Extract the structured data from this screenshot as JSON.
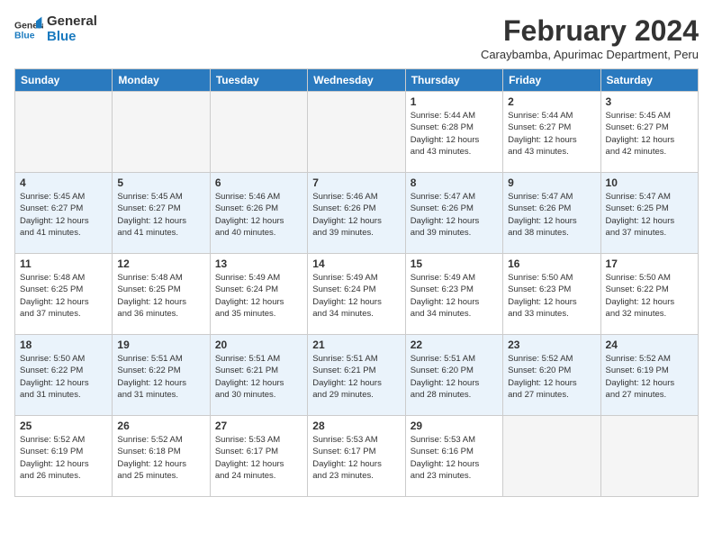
{
  "logo": {
    "text_general": "General",
    "text_blue": "Blue"
  },
  "header": {
    "month_title": "February 2024",
    "subtitle": "Caraybamba, Apurimac Department, Peru"
  },
  "days_of_week": [
    "Sunday",
    "Monday",
    "Tuesday",
    "Wednesday",
    "Thursday",
    "Friday",
    "Saturday"
  ],
  "weeks": [
    [
      {
        "day": "",
        "info": ""
      },
      {
        "day": "",
        "info": ""
      },
      {
        "day": "",
        "info": ""
      },
      {
        "day": "",
        "info": ""
      },
      {
        "day": "1",
        "info": "Sunrise: 5:44 AM\nSunset: 6:28 PM\nDaylight: 12 hours\nand 43 minutes."
      },
      {
        "day": "2",
        "info": "Sunrise: 5:44 AM\nSunset: 6:27 PM\nDaylight: 12 hours\nand 43 minutes."
      },
      {
        "day": "3",
        "info": "Sunrise: 5:45 AM\nSunset: 6:27 PM\nDaylight: 12 hours\nand 42 minutes."
      }
    ],
    [
      {
        "day": "4",
        "info": "Sunrise: 5:45 AM\nSunset: 6:27 PM\nDaylight: 12 hours\nand 41 minutes."
      },
      {
        "day": "5",
        "info": "Sunrise: 5:45 AM\nSunset: 6:27 PM\nDaylight: 12 hours\nand 41 minutes."
      },
      {
        "day": "6",
        "info": "Sunrise: 5:46 AM\nSunset: 6:26 PM\nDaylight: 12 hours\nand 40 minutes."
      },
      {
        "day": "7",
        "info": "Sunrise: 5:46 AM\nSunset: 6:26 PM\nDaylight: 12 hours\nand 39 minutes."
      },
      {
        "day": "8",
        "info": "Sunrise: 5:47 AM\nSunset: 6:26 PM\nDaylight: 12 hours\nand 39 minutes."
      },
      {
        "day": "9",
        "info": "Sunrise: 5:47 AM\nSunset: 6:26 PM\nDaylight: 12 hours\nand 38 minutes."
      },
      {
        "day": "10",
        "info": "Sunrise: 5:47 AM\nSunset: 6:25 PM\nDaylight: 12 hours\nand 37 minutes."
      }
    ],
    [
      {
        "day": "11",
        "info": "Sunrise: 5:48 AM\nSunset: 6:25 PM\nDaylight: 12 hours\nand 37 minutes."
      },
      {
        "day": "12",
        "info": "Sunrise: 5:48 AM\nSunset: 6:25 PM\nDaylight: 12 hours\nand 36 minutes."
      },
      {
        "day": "13",
        "info": "Sunrise: 5:49 AM\nSunset: 6:24 PM\nDaylight: 12 hours\nand 35 minutes."
      },
      {
        "day": "14",
        "info": "Sunrise: 5:49 AM\nSunset: 6:24 PM\nDaylight: 12 hours\nand 34 minutes."
      },
      {
        "day": "15",
        "info": "Sunrise: 5:49 AM\nSunset: 6:23 PM\nDaylight: 12 hours\nand 34 minutes."
      },
      {
        "day": "16",
        "info": "Sunrise: 5:50 AM\nSunset: 6:23 PM\nDaylight: 12 hours\nand 33 minutes."
      },
      {
        "day": "17",
        "info": "Sunrise: 5:50 AM\nSunset: 6:22 PM\nDaylight: 12 hours\nand 32 minutes."
      }
    ],
    [
      {
        "day": "18",
        "info": "Sunrise: 5:50 AM\nSunset: 6:22 PM\nDaylight: 12 hours\nand 31 minutes."
      },
      {
        "day": "19",
        "info": "Sunrise: 5:51 AM\nSunset: 6:22 PM\nDaylight: 12 hours\nand 31 minutes."
      },
      {
        "day": "20",
        "info": "Sunrise: 5:51 AM\nSunset: 6:21 PM\nDaylight: 12 hours\nand 30 minutes."
      },
      {
        "day": "21",
        "info": "Sunrise: 5:51 AM\nSunset: 6:21 PM\nDaylight: 12 hours\nand 29 minutes."
      },
      {
        "day": "22",
        "info": "Sunrise: 5:51 AM\nSunset: 6:20 PM\nDaylight: 12 hours\nand 28 minutes."
      },
      {
        "day": "23",
        "info": "Sunrise: 5:52 AM\nSunset: 6:20 PM\nDaylight: 12 hours\nand 27 minutes."
      },
      {
        "day": "24",
        "info": "Sunrise: 5:52 AM\nSunset: 6:19 PM\nDaylight: 12 hours\nand 27 minutes."
      }
    ],
    [
      {
        "day": "25",
        "info": "Sunrise: 5:52 AM\nSunset: 6:19 PM\nDaylight: 12 hours\nand 26 minutes."
      },
      {
        "day": "26",
        "info": "Sunrise: 5:52 AM\nSunset: 6:18 PM\nDaylight: 12 hours\nand 25 minutes."
      },
      {
        "day": "27",
        "info": "Sunrise: 5:53 AM\nSunset: 6:17 PM\nDaylight: 12 hours\nand 24 minutes."
      },
      {
        "day": "28",
        "info": "Sunrise: 5:53 AM\nSunset: 6:17 PM\nDaylight: 12 hours\nand 23 minutes."
      },
      {
        "day": "29",
        "info": "Sunrise: 5:53 AM\nSunset: 6:16 PM\nDaylight: 12 hours\nand 23 minutes."
      },
      {
        "day": "",
        "info": ""
      },
      {
        "day": "",
        "info": ""
      }
    ]
  ]
}
